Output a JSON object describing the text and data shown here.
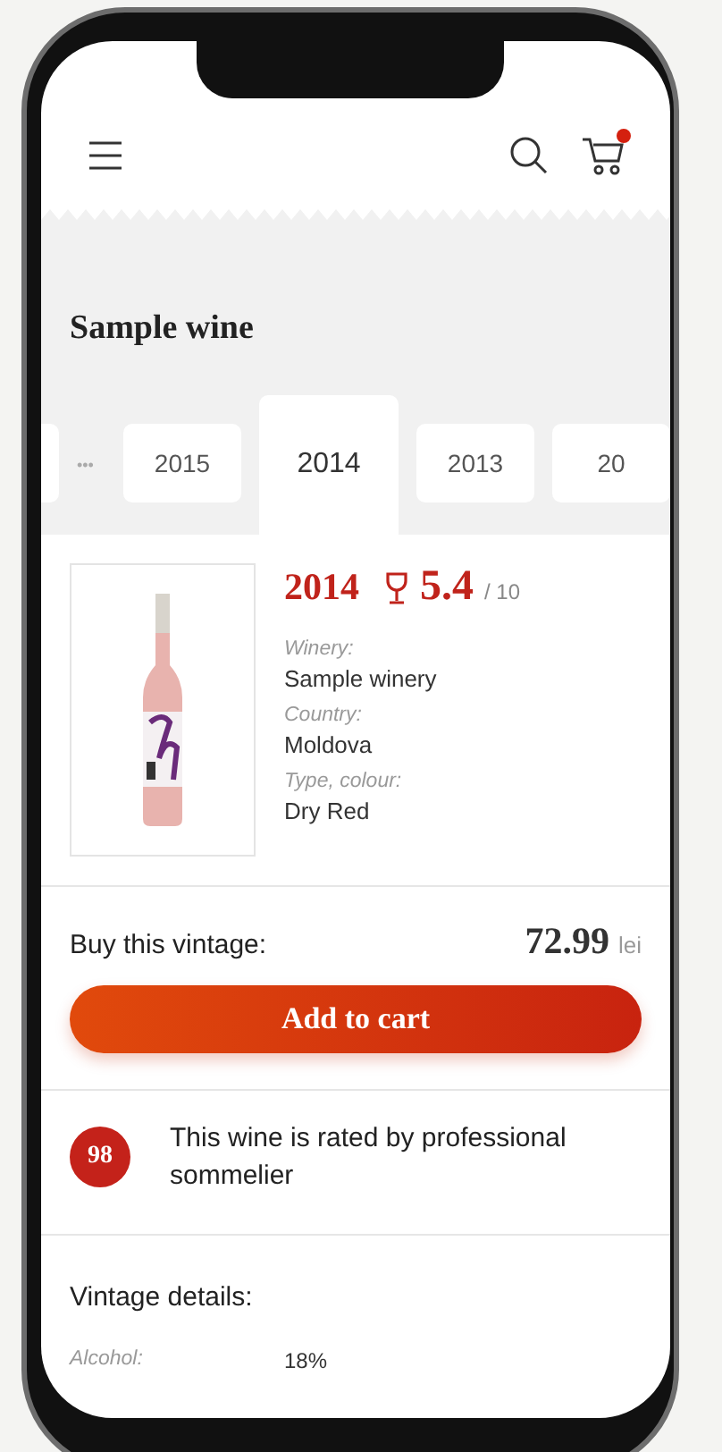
{
  "header": {
    "cart_badge": true
  },
  "title": "Sample wine",
  "vintages": [
    {
      "kind": "blank",
      "selected": false
    },
    {
      "kind": "more",
      "label": "•••",
      "selected": false
    },
    {
      "kind": "year",
      "label": "2015",
      "selected": false
    },
    {
      "kind": "year",
      "label": "2014",
      "selected": true
    },
    {
      "kind": "year",
      "label": "2013",
      "selected": false
    },
    {
      "kind": "year",
      "label": "20",
      "selected": false
    }
  ],
  "product": {
    "year": "2014",
    "rating": "5.4",
    "rating_max": "/ 10",
    "details": [
      {
        "label": "Winery:",
        "value": "Sample winery"
      },
      {
        "label": "Country:",
        "value": "Moldova"
      },
      {
        "label": "Type, colour:",
        "value": "Dry Red"
      }
    ]
  },
  "purchase": {
    "label": "Buy this vintage:",
    "price": "72.99",
    "currency": "lei",
    "button": "Add to cart"
  },
  "sommelier": {
    "score": "98",
    "text": "This wine is rated by professional sommelier"
  },
  "vintage_details": {
    "heading": "Vintage details:",
    "rows": [
      {
        "label": "Alcohol:",
        "value": "18%"
      }
    ]
  }
}
